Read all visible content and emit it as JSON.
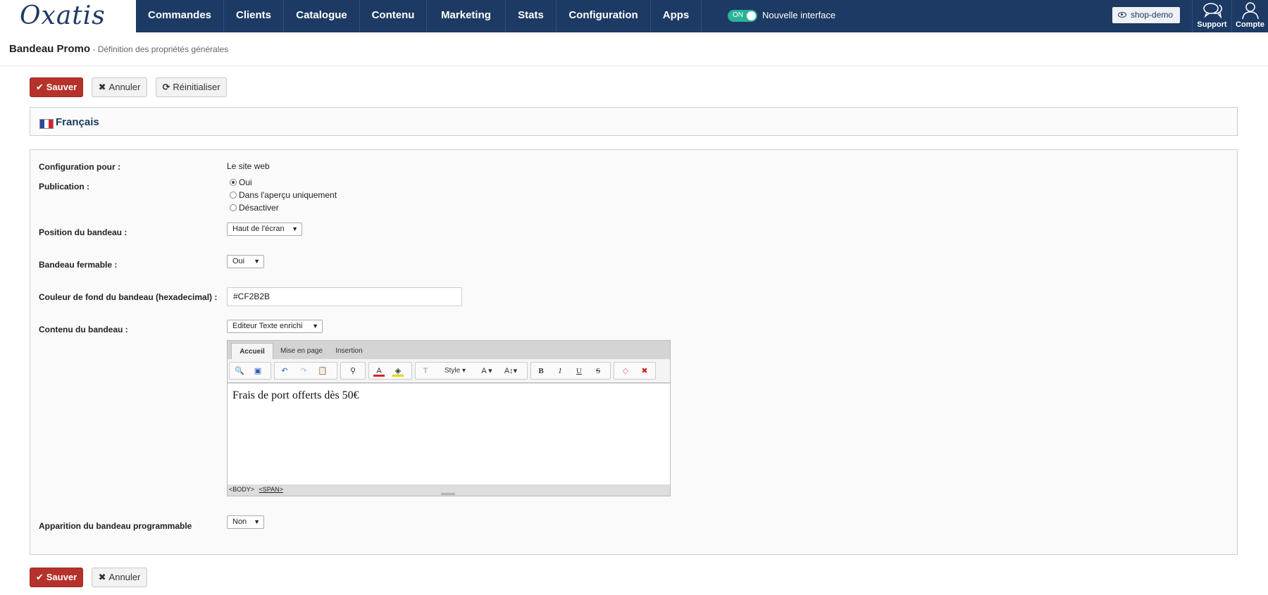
{
  "logo": "Oxatis",
  "nav": {
    "items": [
      "Commandes",
      "Clients",
      "Catalogue",
      "Contenu",
      "Marketing",
      "Stats",
      "Configuration",
      "Apps"
    ],
    "toggle_state": "ON",
    "toggle_text": "Nouvelle interface",
    "shop_label": "shop-demo",
    "support_label": "Support",
    "account_label": "Compte"
  },
  "page": {
    "title": "Bandeau Promo",
    "subtitle": " - Définition des propriétés générales"
  },
  "toolbar": {
    "save_label": "Sauver",
    "cancel_label": "Annuler",
    "reset_label": "Réinitialiser"
  },
  "language": {
    "label": "Français"
  },
  "form": {
    "config_label": "Configuration pour :",
    "config_value": "Le site web",
    "publication_label": "Publication :",
    "publication_options": [
      "Oui",
      "Dans l'aperçu uniquement",
      "Désactiver"
    ],
    "publication_selected": "Oui",
    "position_label": "Position du bandeau :",
    "position_value": "Haut de l'écran",
    "closable_label": "Bandeau fermable :",
    "closable_value": "Oui",
    "color_label": "Couleur de fond du bandeau (hexadecimal) :",
    "color_value": "#CF2B2B",
    "content_label": "Contenu du bandeau :",
    "content_mode": "Editeur Texte enrichi",
    "schedule_label": "Apparition du bandeau programmable",
    "schedule_value": "Non"
  },
  "editor": {
    "tabs": [
      "Accueil",
      "Mise en page",
      "Insertion"
    ],
    "style_label": "Style",
    "content": "Frais de port offerts dès 50€",
    "status_body": "<BODY>",
    "status_span": "<SPAN>"
  },
  "colors": {
    "nav_bg": "#1c3a63",
    "save_bg": "#b5322b",
    "toggle_on": "#2bb39a"
  }
}
